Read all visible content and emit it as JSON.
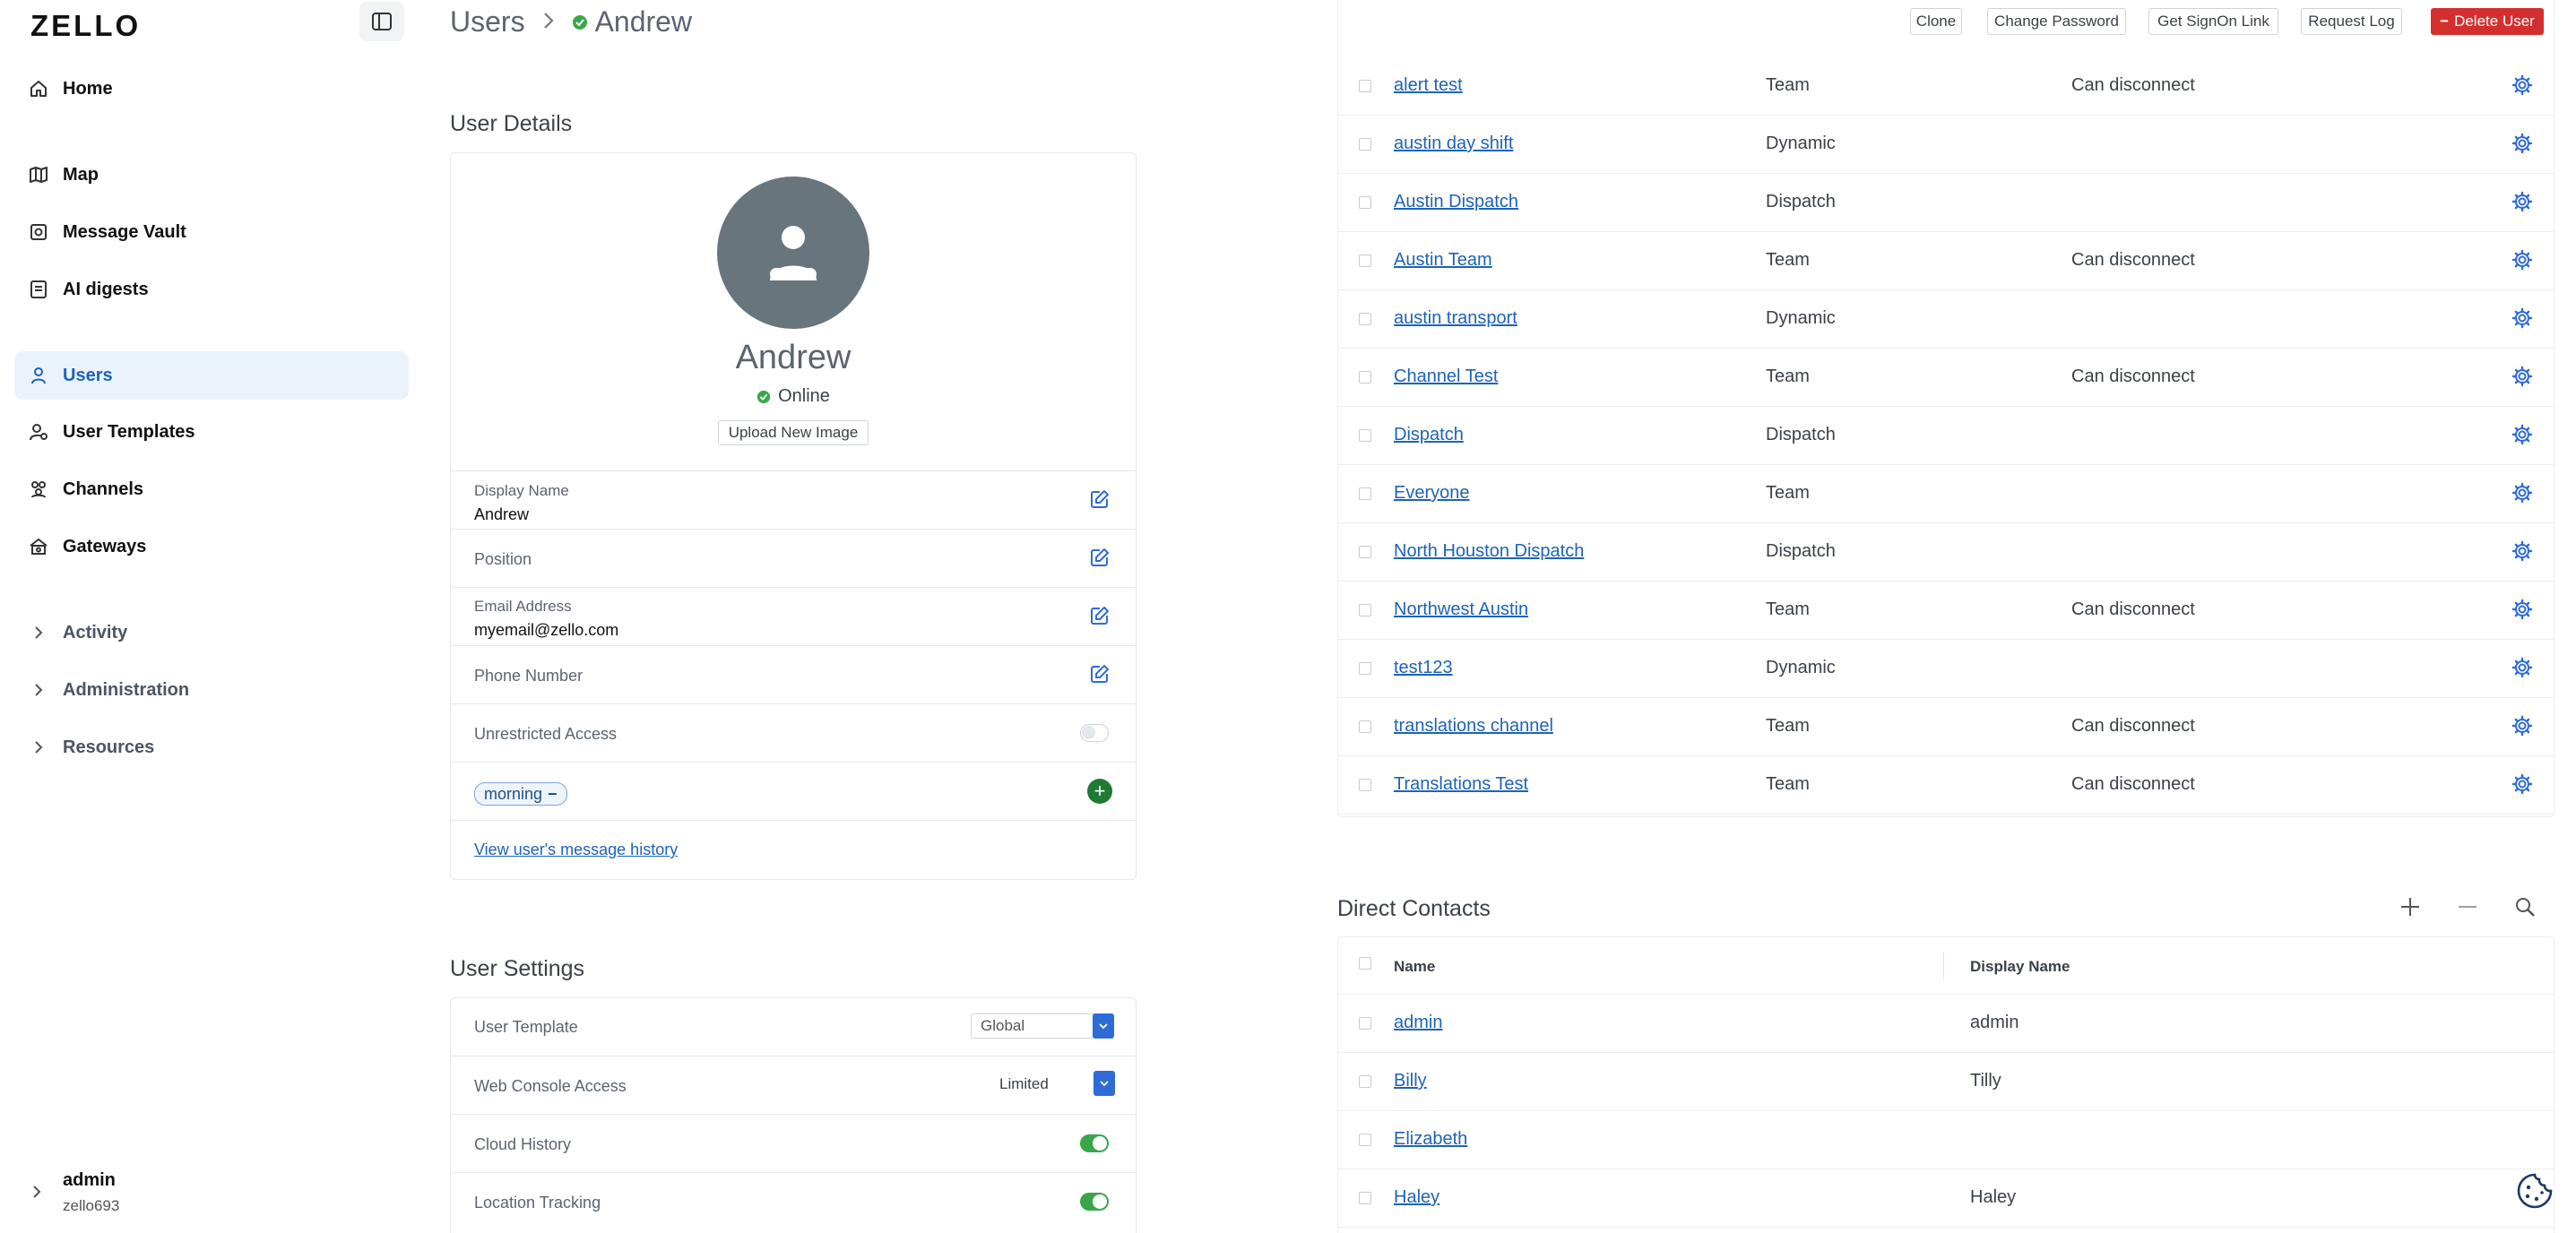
{
  "sidebar": {
    "logo": "ZELLO",
    "items": [
      {
        "label": "Home",
        "icon": "home-icon"
      },
      {
        "label": "Map",
        "icon": "map-icon"
      },
      {
        "label": "Message Vault",
        "icon": "vault-icon"
      },
      {
        "label": "AI digests",
        "icon": "digest-icon"
      },
      {
        "label": "Users",
        "icon": "user-icon",
        "active": true
      },
      {
        "label": "User Templates",
        "icon": "template-icon"
      },
      {
        "label": "Channels",
        "icon": "channels-icon"
      },
      {
        "label": "Gateways",
        "icon": "gateway-icon"
      },
      {
        "label": "Activity",
        "icon": "chevron-right-icon"
      },
      {
        "label": "Administration",
        "icon": "chevron-right-icon"
      },
      {
        "label": "Resources",
        "icon": "chevron-right-icon"
      }
    ],
    "account": {
      "name": "admin",
      "network": "zello693"
    }
  },
  "header": {
    "crumb_root": "Users",
    "crumb_current": "Andrew",
    "buttons": {
      "clone": "Clone",
      "change_password": "Change Password",
      "signon_link": "Get SignOn Link",
      "request_log": "Request Log",
      "delete_user": "Delete User"
    }
  },
  "user_details": {
    "title": "User Details",
    "name": "Andrew",
    "status": "Online",
    "upload_label": "Upload New Image",
    "display_name_label": "Display Name",
    "display_name_value": "Andrew",
    "position_label": "Position",
    "email_label": "Email Address",
    "email_value": "myemail@zello.com",
    "phone_label": "Phone Number",
    "unrestricted_label": "Unrestricted Access",
    "tag": "morning",
    "history_link": "View user's message history"
  },
  "user_settings": {
    "title": "User Settings",
    "template_label": "User Template",
    "template_value": "Global",
    "web_console_label": "Web Console Access",
    "web_console_value": "Limited",
    "cloud_history_label": "Cloud History",
    "location_tracking_label": "Location Tracking"
  },
  "channels": [
    {
      "name": "alert test",
      "type": "Team",
      "perm": "Can disconnect"
    },
    {
      "name": "austin day shift",
      "type": "Dynamic",
      "perm": ""
    },
    {
      "name": "Austin Dispatch",
      "type": "Dispatch",
      "perm": ""
    },
    {
      "name": "Austin Team",
      "type": "Team",
      "perm": "Can disconnect"
    },
    {
      "name": "austin transport",
      "type": "Dynamic",
      "perm": ""
    },
    {
      "name": "Channel Test",
      "type": "Team",
      "perm": "Can disconnect"
    },
    {
      "name": "Dispatch",
      "type": "Dispatch",
      "perm": ""
    },
    {
      "name": "Everyone",
      "type": "Team",
      "perm": ""
    },
    {
      "name": "North Houston Dispatch",
      "type": "Dispatch",
      "perm": ""
    },
    {
      "name": "Northwest Austin",
      "type": "Team",
      "perm": "Can disconnect"
    },
    {
      "name": "test123",
      "type": "Dynamic",
      "perm": ""
    },
    {
      "name": "translations channel",
      "type": "Team",
      "perm": "Can disconnect"
    },
    {
      "name": "Translations Test",
      "type": "Team",
      "perm": "Can disconnect"
    }
  ],
  "direct_contacts": {
    "title": "Direct Contacts",
    "col_name": "Name",
    "col_display": "Display Name",
    "rows": [
      {
        "name": "admin",
        "display": "admin"
      },
      {
        "name": "Billy",
        "display": "Tilly"
      },
      {
        "name": "Elizabeth",
        "display": ""
      },
      {
        "name": "Haley",
        "display": "Haley"
      }
    ]
  },
  "colors": {
    "accent": "#1d63b8",
    "danger": "#d42f2f",
    "success": "#3aa64a"
  }
}
